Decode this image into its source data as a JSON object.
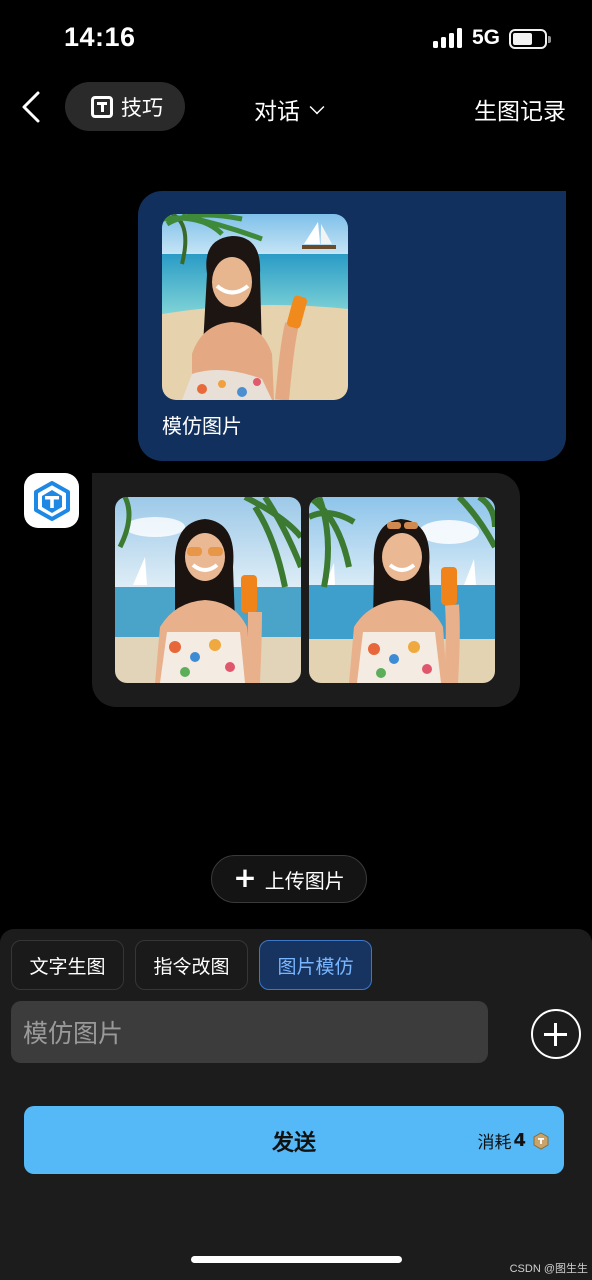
{
  "status_bar": {
    "time": "14:16",
    "network": "5G"
  },
  "nav": {
    "tips_label": "技巧",
    "title": "对话",
    "history_label": "生图记录"
  },
  "conversation": {
    "user_message": {
      "caption": "模仿图片"
    }
  },
  "upload_button": {
    "label": "上传图片"
  },
  "modes": [
    {
      "label": "文字生图",
      "selected": false
    },
    {
      "label": "指令改图",
      "selected": false
    },
    {
      "label": "图片模仿",
      "selected": true
    }
  ],
  "input": {
    "placeholder": "模仿图片"
  },
  "send": {
    "label": "发送",
    "cost_label": "消耗",
    "cost_value": "4"
  },
  "watermark": "CSDN @图生生",
  "colors": {
    "accent": "#55b9f7",
    "user_bubble": "#12305d",
    "selected_mode": "#173460"
  }
}
